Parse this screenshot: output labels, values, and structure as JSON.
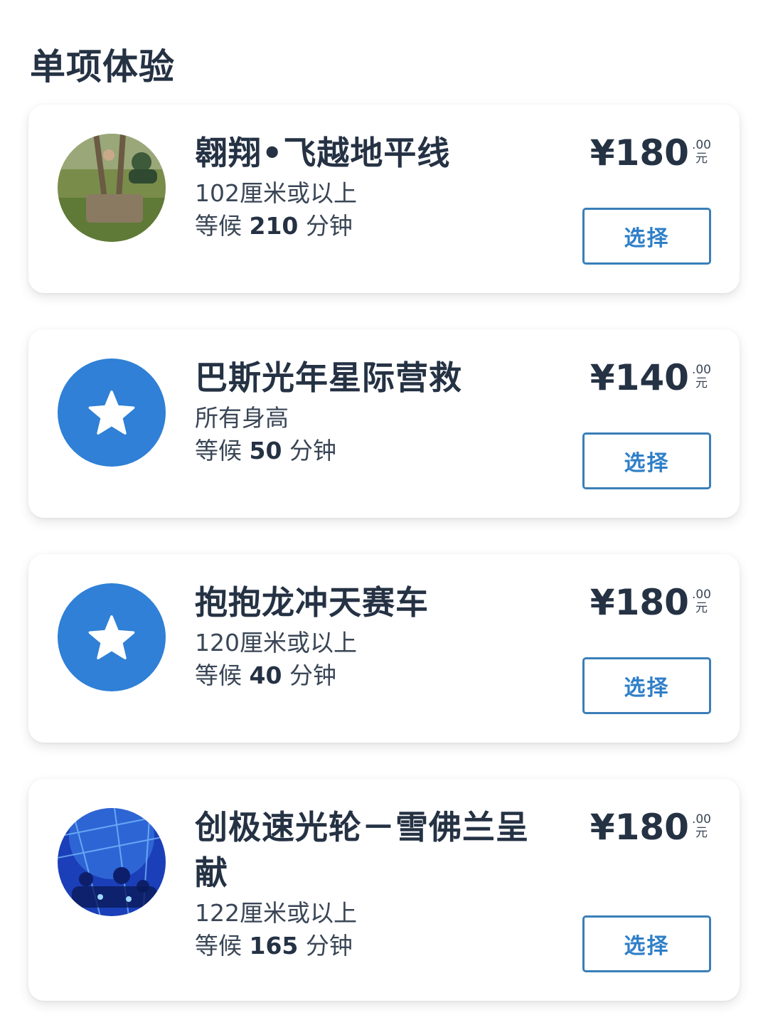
{
  "section": {
    "title": "单项体验"
  },
  "items": [
    {
      "name": "翱翔•飞越地平线",
      "height": "102厘米或以上",
      "wait_prefix": "等候",
      "wait_minutes": "210",
      "wait_suffix": "分钟",
      "price": "¥180",
      "price_cents": ".00",
      "price_unit": "元",
      "button": "选择",
      "icon": "photo-soaring-ride"
    },
    {
      "name": "巴斯光年星际营救",
      "height": "所有身高",
      "wait_prefix": "等候",
      "wait_minutes": "50",
      "wait_suffix": "分钟",
      "price": "¥140",
      "price_cents": ".00",
      "price_unit": "元",
      "button": "选择",
      "icon": "star-icon"
    },
    {
      "name": "抱抱龙冲天赛车",
      "height": "120厘米或以上",
      "wait_prefix": "等候",
      "wait_minutes": "40",
      "wait_suffix": "分钟",
      "price": "¥180",
      "price_cents": ".00",
      "price_unit": "元",
      "button": "选择",
      "icon": "star-icon"
    },
    {
      "name": "创极速光轮－雪佛兰呈献",
      "height": "122厘米或以上",
      "wait_prefix": "等候",
      "wait_minutes": "165",
      "wait_suffix": "分钟",
      "price": "¥180",
      "price_cents": ".00",
      "price_unit": "元",
      "button": "选择",
      "icon": "photo-tron-ride"
    }
  ],
  "colors": {
    "accent": "#2f80d6",
    "button_border": "#3a7fb8",
    "text_dark": "#253244"
  }
}
